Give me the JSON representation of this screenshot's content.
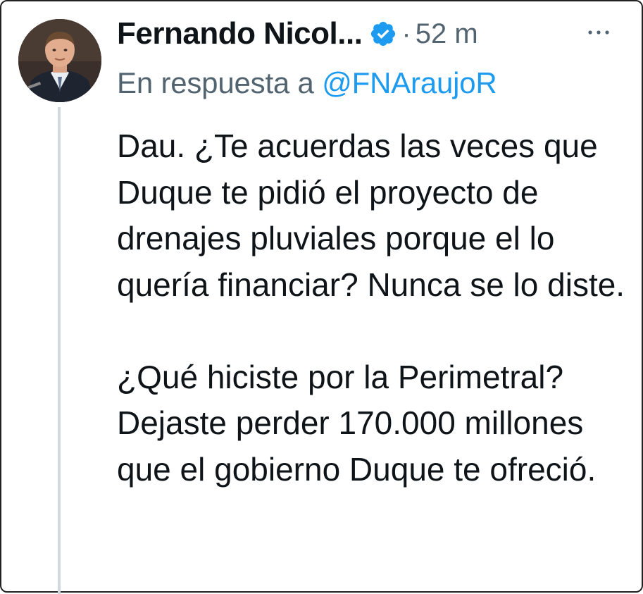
{
  "tweet": {
    "author_name": "Fernando Nicol...",
    "separator": "·",
    "time": "52 m",
    "reply_prefix": "En respuesta a",
    "reply_handle": "@FNAraujoR",
    "paragraph_1": "Dau. ¿Te acuerdas las veces que Duque te pidió el proyecto de drenajes pluviales porque el lo quería financiar? Nunca se lo diste.",
    "paragraph_2": "¿Qué hiciste por la Perimetral? Dejaste perder 170.000 millones que el gobierno Duque te ofreció."
  },
  "icons": {
    "verified": "verified-badge-icon",
    "more": "more-horizontal-icon"
  },
  "colors": {
    "text": "#0f1419",
    "secondary": "#536471",
    "accent": "#1d9bf0",
    "thread_line": "#cfd9de",
    "frame_border": "#222222"
  }
}
